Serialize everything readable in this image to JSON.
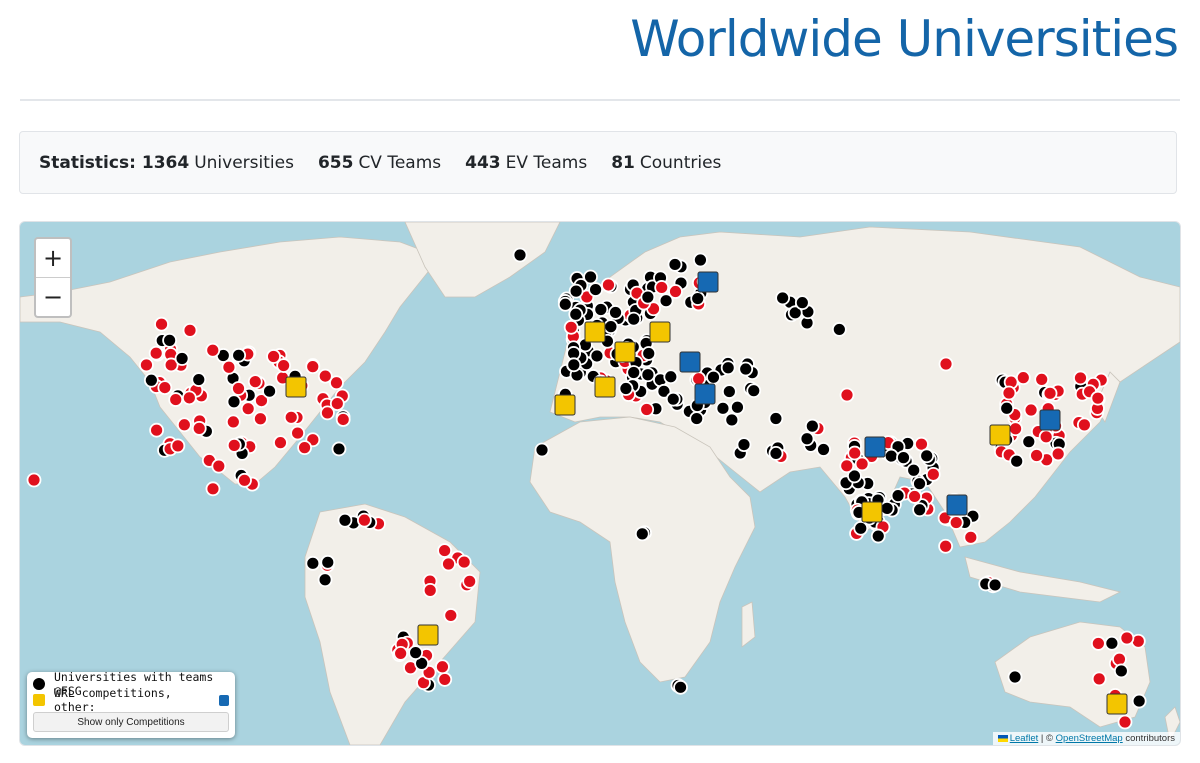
{
  "header": {
    "title": "Worldwide Universities"
  },
  "stats": {
    "label": "Statistics:",
    "universities": {
      "value": "1364",
      "label": "Universities"
    },
    "cv_teams": {
      "value": "655",
      "label": "CV Teams"
    },
    "ev_teams": {
      "value": "443",
      "label": "EV Teams"
    },
    "countries": {
      "value": "81",
      "label": "Countries"
    }
  },
  "map": {
    "zoom_in": "+",
    "zoom_out": "−",
    "colors": {
      "ocean": "#aad3df",
      "land": "#f2efe9",
      "fsg_team": "#000000",
      "university": "#e0101d",
      "wrl_competition": "#f3c500",
      "other_competition": "#1669b3"
    },
    "legend": {
      "fsg_label": "Universities with teams @FSG",
      "competitions_label": "WRL competitions, other:",
      "button_label": "Show only Competitions"
    },
    "attribution": {
      "leaflet": "Leaflet",
      "separator": " | © ",
      "osm": "OpenStreetMap",
      "suffix": " contributors"
    }
  }
}
